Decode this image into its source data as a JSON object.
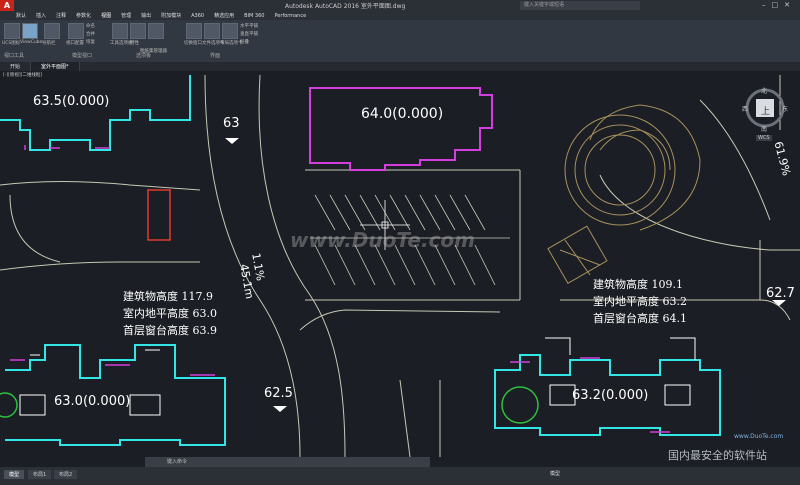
{
  "app": {
    "title": "Autodesk AutoCAD 2016   室外平面图.dwg",
    "logo": "A",
    "search_placeholder": "键入关键字或短语"
  },
  "ribbon_tabs": [
    "默认",
    "插入",
    "注释",
    "参数化",
    "视图",
    "管理",
    "输出",
    "附加模块",
    "A360",
    "精选应用",
    "BIM 360",
    "Performance"
  ],
  "ribbon": {
    "panels": [
      {
        "name": "视口工具"
      },
      {
        "name": "模型视口"
      },
      {
        "name": "选项板"
      },
      {
        "name": "界面"
      }
    ],
    "buttons": [
      "UCS图标",
      "ViewCube",
      "导航栏",
      "视口配置",
      "命名",
      "合并",
      "恢复",
      "工具选项板",
      "特性",
      "图纸集管理器",
      "切换窗口",
      "文件选项卡",
      "布局选项卡",
      "水平平铺",
      "垂直平铺",
      "层叠"
    ]
  },
  "doc_tabs": [
    "开始",
    "室外平面图*"
  ],
  "viewport_label": "[-][俯视][二维线框]",
  "viewcube": {
    "north": "北",
    "south": "南",
    "east": "东",
    "west": "西",
    "center": "上",
    "wcs": "WCS"
  },
  "drawing": {
    "elev_labels": [
      "63.5(0.000)",
      "64.0(0.000)",
      "63.0(0.000)",
      "63.2(0.000)"
    ],
    "spot_labels": [
      "63",
      "62.5",
      "62.7"
    ],
    "slope_label": "1.1%",
    "length_label": "45.1m",
    "right_rot_label": "61.9%",
    "left_info": [
      "建筑物高度 117.9",
      "室内地平高度 63.0",
      "首层窗台高度 63.9"
    ],
    "right_info": [
      "建筑物高度 109.1",
      "室内地平高度 63.2",
      "首层窗台高度 64.1"
    ],
    "watermark": "www.DuoTe.com"
  },
  "command_placeholder": "键入命令",
  "status": {
    "tabs": [
      "模型",
      "布局1",
      "布局2"
    ],
    "mode": "模型"
  },
  "site_watermark": {
    "cn": "国内最安全的软件站",
    "url": "www.DuoTe.com"
  },
  "colors": {
    "background": "#1b1e24",
    "cyan": "#33e6e6",
    "magenta": "#d23fdc",
    "road": "#c7c8b4",
    "tan": "#a8905d",
    "red": "#e03b30",
    "green": "#2fbf3f"
  }
}
